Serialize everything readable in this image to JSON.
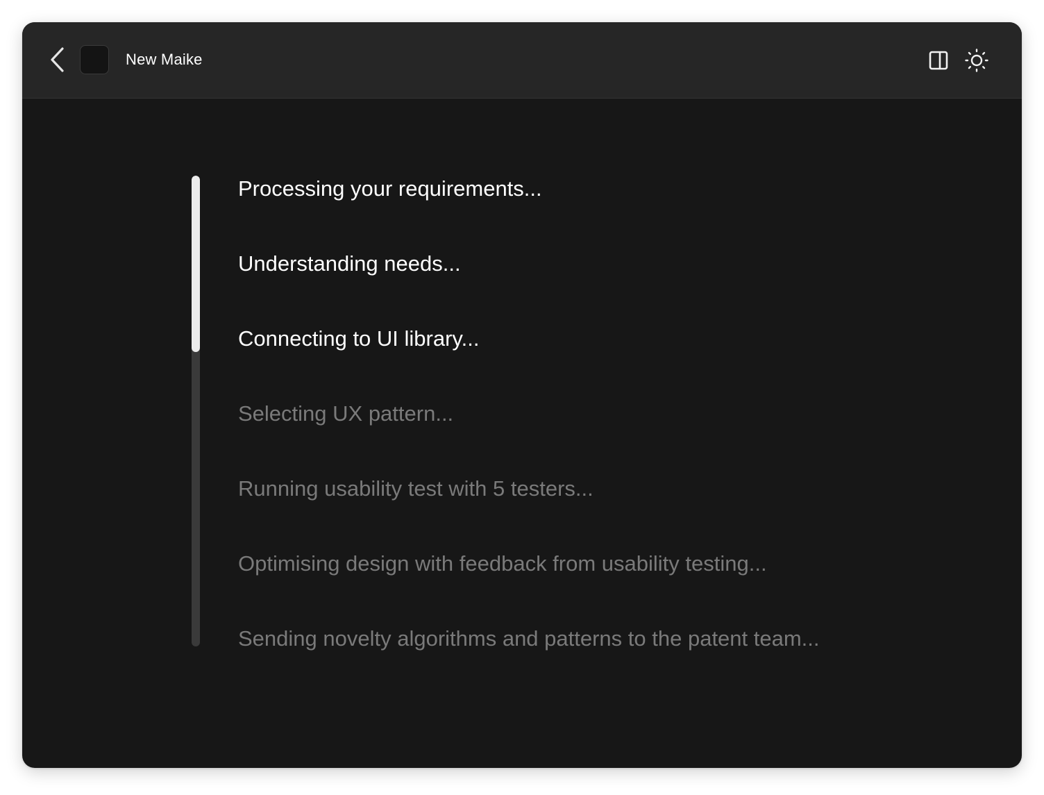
{
  "window": {
    "title": "New Maike"
  },
  "icons": {
    "back": "chevron-left-icon",
    "app": "app-icon",
    "panel": "sidebar-panel-icon",
    "theme": "sun-icon"
  },
  "colors": {
    "window_bg": "#171717",
    "titlebar_bg": "#262626",
    "text_active": "#ffffff",
    "text_pending": "#7a7a7a",
    "progress_fill": "#ececec",
    "progress_track": "#3a3a3a"
  },
  "progress": {
    "fraction": 0.375
  },
  "steps": [
    {
      "label": "Processing your requirements...",
      "status": "done"
    },
    {
      "label": "Understanding needs...",
      "status": "done"
    },
    {
      "label": "Connecting to UI library...",
      "status": "done"
    },
    {
      "label": "Selecting UX pattern...",
      "status": "pending"
    },
    {
      "label": "Running usability test with 5 testers...",
      "status": "pending"
    },
    {
      "label": "Optimising design with feedback from usability testing...",
      "status": "pending"
    },
    {
      "label": "Sending novelty algorithms and patterns to the patent team...",
      "status": "pending"
    }
  ]
}
